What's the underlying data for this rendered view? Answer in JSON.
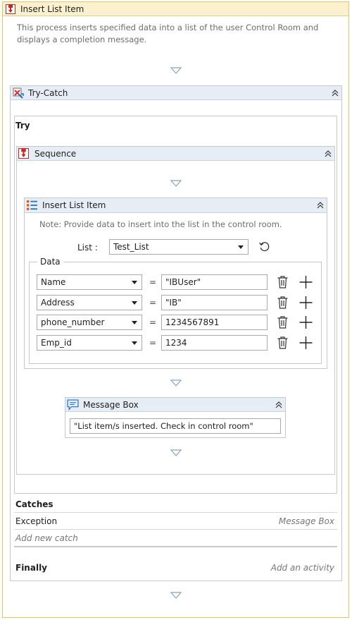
{
  "outer": {
    "title": "Insert List Item",
    "description": "This process inserts specified data into a list of the user Control Room and displays a completion message."
  },
  "try_catch": {
    "title": "Try-Catch",
    "try_label": "Try",
    "catches_label": "Catches",
    "exception_label": "Exception",
    "exception_action": "Message Box",
    "add_catch": "Add new catch",
    "finally_label": "Finally",
    "add_activity": "Add an activity"
  },
  "sequence": {
    "title": "Sequence"
  },
  "insert_list_item": {
    "title": "Insert List Item",
    "note": "Note: Provide data to insert into the list in the control room.",
    "list_label": "List :",
    "list_value": "Test_List",
    "data_label": "Data",
    "rows": [
      {
        "field": "Name",
        "eq": "=",
        "value": "\"IBUser\""
      },
      {
        "field": "Address",
        "eq": "=",
        "value": "\"IB\""
      },
      {
        "field": "phone_number",
        "eq": "=",
        "value": "1234567891"
      },
      {
        "field": "Emp_id",
        "eq": "=",
        "value": "1234"
      }
    ]
  },
  "message_box": {
    "title": "Message Box",
    "text": "\"List item/s inserted. Check in control room\""
  },
  "icons": {
    "sequence": "sequence-icon",
    "try_catch": "try-catch-icon",
    "list": "list-icon",
    "message": "message-box-icon",
    "collapse": "collapse-icon",
    "refresh": "refresh-icon",
    "delete": "trash-icon",
    "add": "plus-icon"
  }
}
